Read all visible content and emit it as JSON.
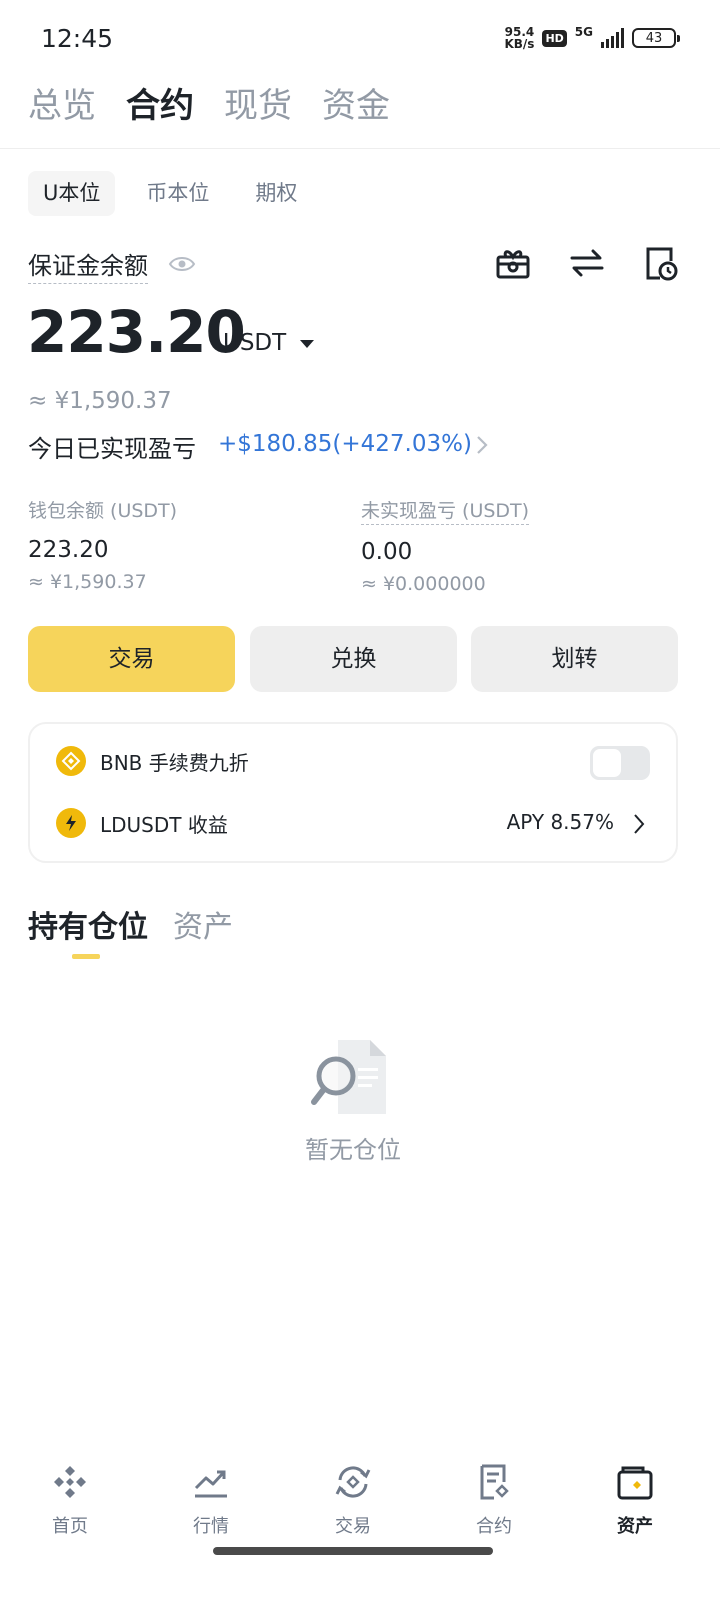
{
  "status_bar": {
    "time": "12:45",
    "speed_top": "95.4",
    "speed_bottom": "KB/s",
    "hd": "HD",
    "network": "5G",
    "battery": "43"
  },
  "top_tabs": [
    "总览",
    "合约",
    "现货",
    "资金"
  ],
  "top_tab_active": "合约",
  "sub_tabs": [
    "U本位",
    "币本位",
    "期权"
  ],
  "sub_tab_active": "U本位",
  "balance": {
    "label": "保证金余额",
    "amount": "223.20",
    "unit": "USDT",
    "approx": "≈ ¥1,590.37",
    "pnl_label": "今日已实现盈亏",
    "pnl_value": "+$180.85(+427.03%)"
  },
  "header_icons": [
    "gift-icon",
    "transfer-arrows-icon",
    "history-document-icon"
  ],
  "wallet": {
    "label": "钱包余额 (USDT)",
    "value": "223.20",
    "approx": "≈ ¥1,590.37"
  },
  "unrealized": {
    "label": "未实现盈亏 (USDT)",
    "value": "0.00",
    "approx": "≈ ¥0.000000"
  },
  "actions": {
    "trade": "交易",
    "convert": "兑换",
    "transfer": "划转"
  },
  "card": {
    "bnb_label": "BNB 手续费九折",
    "bnb_toggle_on": false,
    "ldusdt_label": "LDUSDT 收益",
    "apy": "APY 8.57%"
  },
  "holdings_tabs": {
    "positions": "持有仓位",
    "assets": "资产"
  },
  "empty_text": "暂无仓位",
  "bottom_nav": {
    "home": "首页",
    "markets": "行情",
    "trade": "交易",
    "futures": "合约",
    "assets": "资产"
  },
  "colors": {
    "accent_yellow": "#F6D45B",
    "pnl_blue": "#3375D7",
    "coin_gold": "#F0B90B"
  }
}
